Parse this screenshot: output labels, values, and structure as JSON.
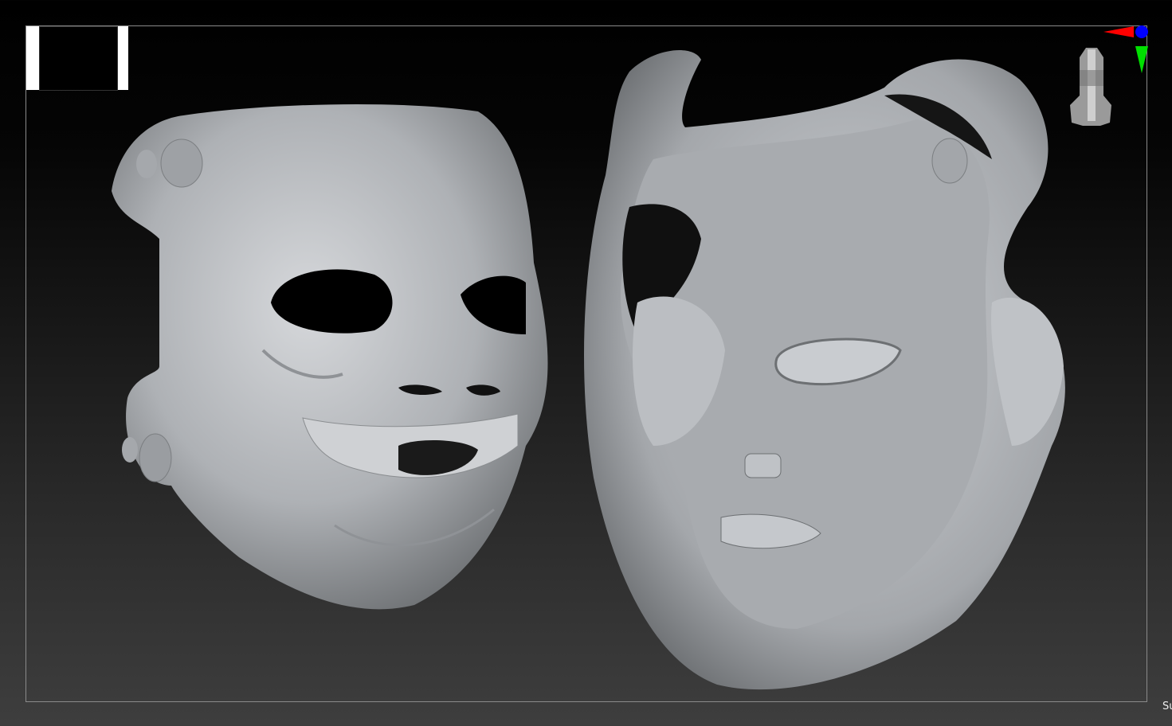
{
  "status_text": "Su",
  "colors": {
    "axis_x": "#ff0000",
    "axis_y": "#00e000",
    "axis_z": "#0000ff",
    "clay": "#b9bcc0"
  },
  "icons": [
    "navigation-thumbnail",
    "orientation-gizmo-icon",
    "head-navigation-icon"
  ]
}
